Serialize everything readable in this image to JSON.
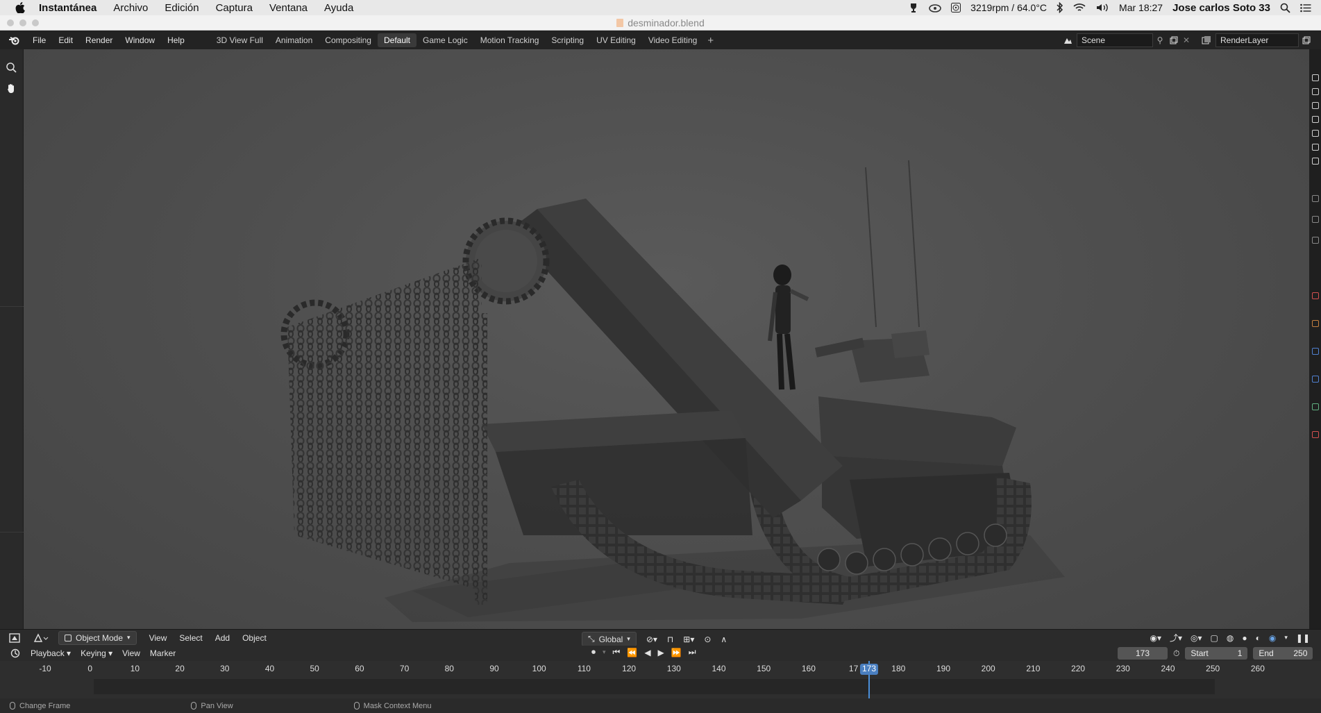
{
  "mac_menubar": {
    "app_name": "Instantánea",
    "menus": [
      "Archivo",
      "Edición",
      "Captura",
      "Ventana",
      "Ayuda"
    ],
    "status": {
      "fan_temp": "3219rpm / 64.0°C",
      "datetime": "Mar 18:27",
      "user": "Jose carlos Soto 33"
    }
  },
  "window": {
    "title": "desminador.blend"
  },
  "blender_topbar": {
    "menus": [
      "File",
      "Edit",
      "Render",
      "Window",
      "Help"
    ],
    "workspaces": [
      "3D View Full",
      "Animation",
      "Compositing",
      "Default",
      "Game Logic",
      "Motion Tracking",
      "Scripting",
      "UV Editing",
      "Video Editing"
    ],
    "active_workspace": "Default",
    "add_workspace": "+",
    "scene": "Scene",
    "render_layer": "RenderLayer"
  },
  "viewport_header": {
    "mode": "Object Mode",
    "menus": [
      "View",
      "Select",
      "Add",
      "Object"
    ],
    "orientation": "Global"
  },
  "timeline_header": {
    "menus": [
      "Playback",
      "Keying",
      "View",
      "Marker"
    ],
    "current_frame": "173",
    "start_label": "Start",
    "start_value": "1",
    "end_label": "End",
    "end_value": "250"
  },
  "timeline_ruler": {
    "ticks": [
      "-10",
      "0",
      "10",
      "20",
      "30",
      "40",
      "50",
      "60",
      "70",
      "80",
      "90",
      "100",
      "110",
      "120",
      "130",
      "140",
      "150",
      "160",
      "17",
      "180",
      "190",
      "200",
      "210",
      "220",
      "230",
      "240",
      "250",
      "260"
    ],
    "current_frame_label": "173"
  },
  "statusbar": {
    "hints": [
      "Change Frame",
      "Pan View",
      "Mask Context Menu"
    ]
  },
  "colors": {
    "accent": "#4a7fc0",
    "viewport_bg": "#4f4f4f",
    "header_bg": "#2b2b2b"
  }
}
